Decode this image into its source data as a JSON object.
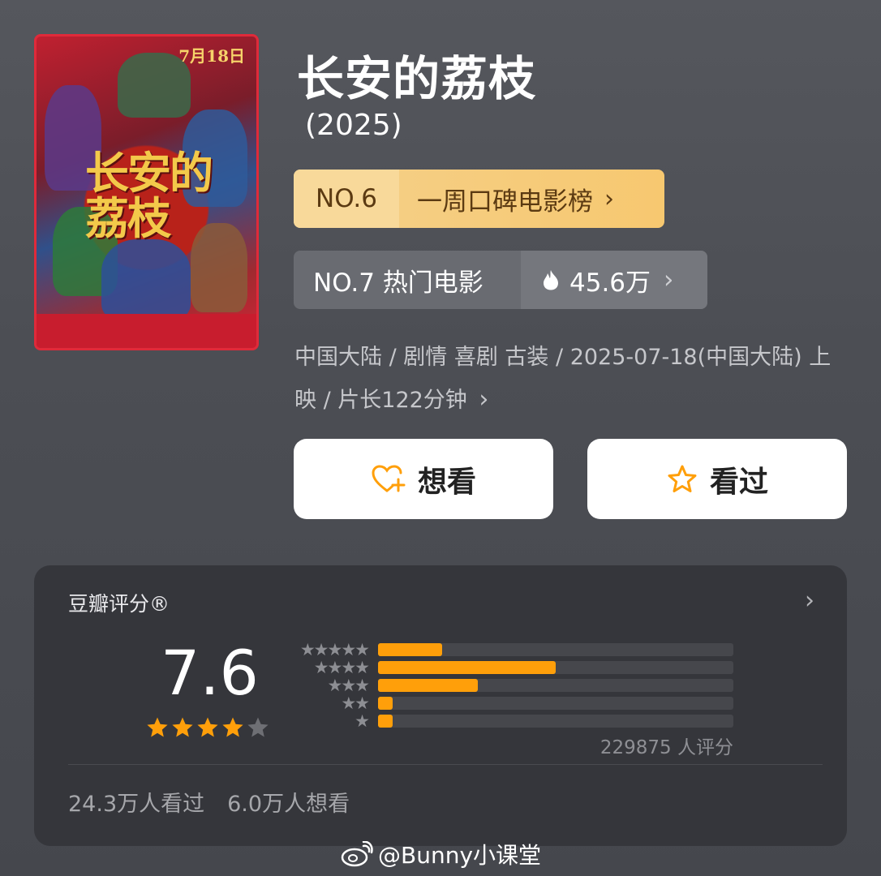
{
  "poster": {
    "date_text": "7月18日",
    "title_text": "长安的荔枝"
  },
  "movie": {
    "title": "长安的荔枝",
    "year": "(2025)"
  },
  "rank_weekly": {
    "number": "NO.6",
    "label": "一周口碑电影榜",
    "chevron": "›"
  },
  "rank_hot": {
    "label": "NO.7 热门电影",
    "heat": "45.6万",
    "chevron": "›"
  },
  "meta": {
    "text": "中国大陆 / 剧情 喜剧 古装 / 2025-07-18(中国大陆) 上映 / 片长122分钟",
    "chevron": "›"
  },
  "actions": {
    "want_label": "想看",
    "seen_label": "看过"
  },
  "rating": {
    "heading": "豆瓣评分®",
    "chevron": "›",
    "score": "7.6",
    "stars_filled": 4,
    "stars_total": 5,
    "distribution": [
      {
        "stars": "★★★★★",
        "fraction": 0.18
      },
      {
        "stars": "★★★★",
        "fraction": 0.5
      },
      {
        "stars": "★★★",
        "fraction": 0.28
      },
      {
        "stars": "★★",
        "fraction": 0.04
      },
      {
        "stars": "★",
        "fraction": 0.04
      }
    ],
    "count_text": "229875 人评分",
    "seen_text": "24.3万人看过",
    "want_text": "6.0万人想看"
  },
  "watermark": {
    "text": "@Bunny小课堂"
  },
  "colors": {
    "accent": "#ff9f0a",
    "gold_badge": "#f7c870",
    "background": "#4c4e54",
    "card": "#35363b"
  }
}
